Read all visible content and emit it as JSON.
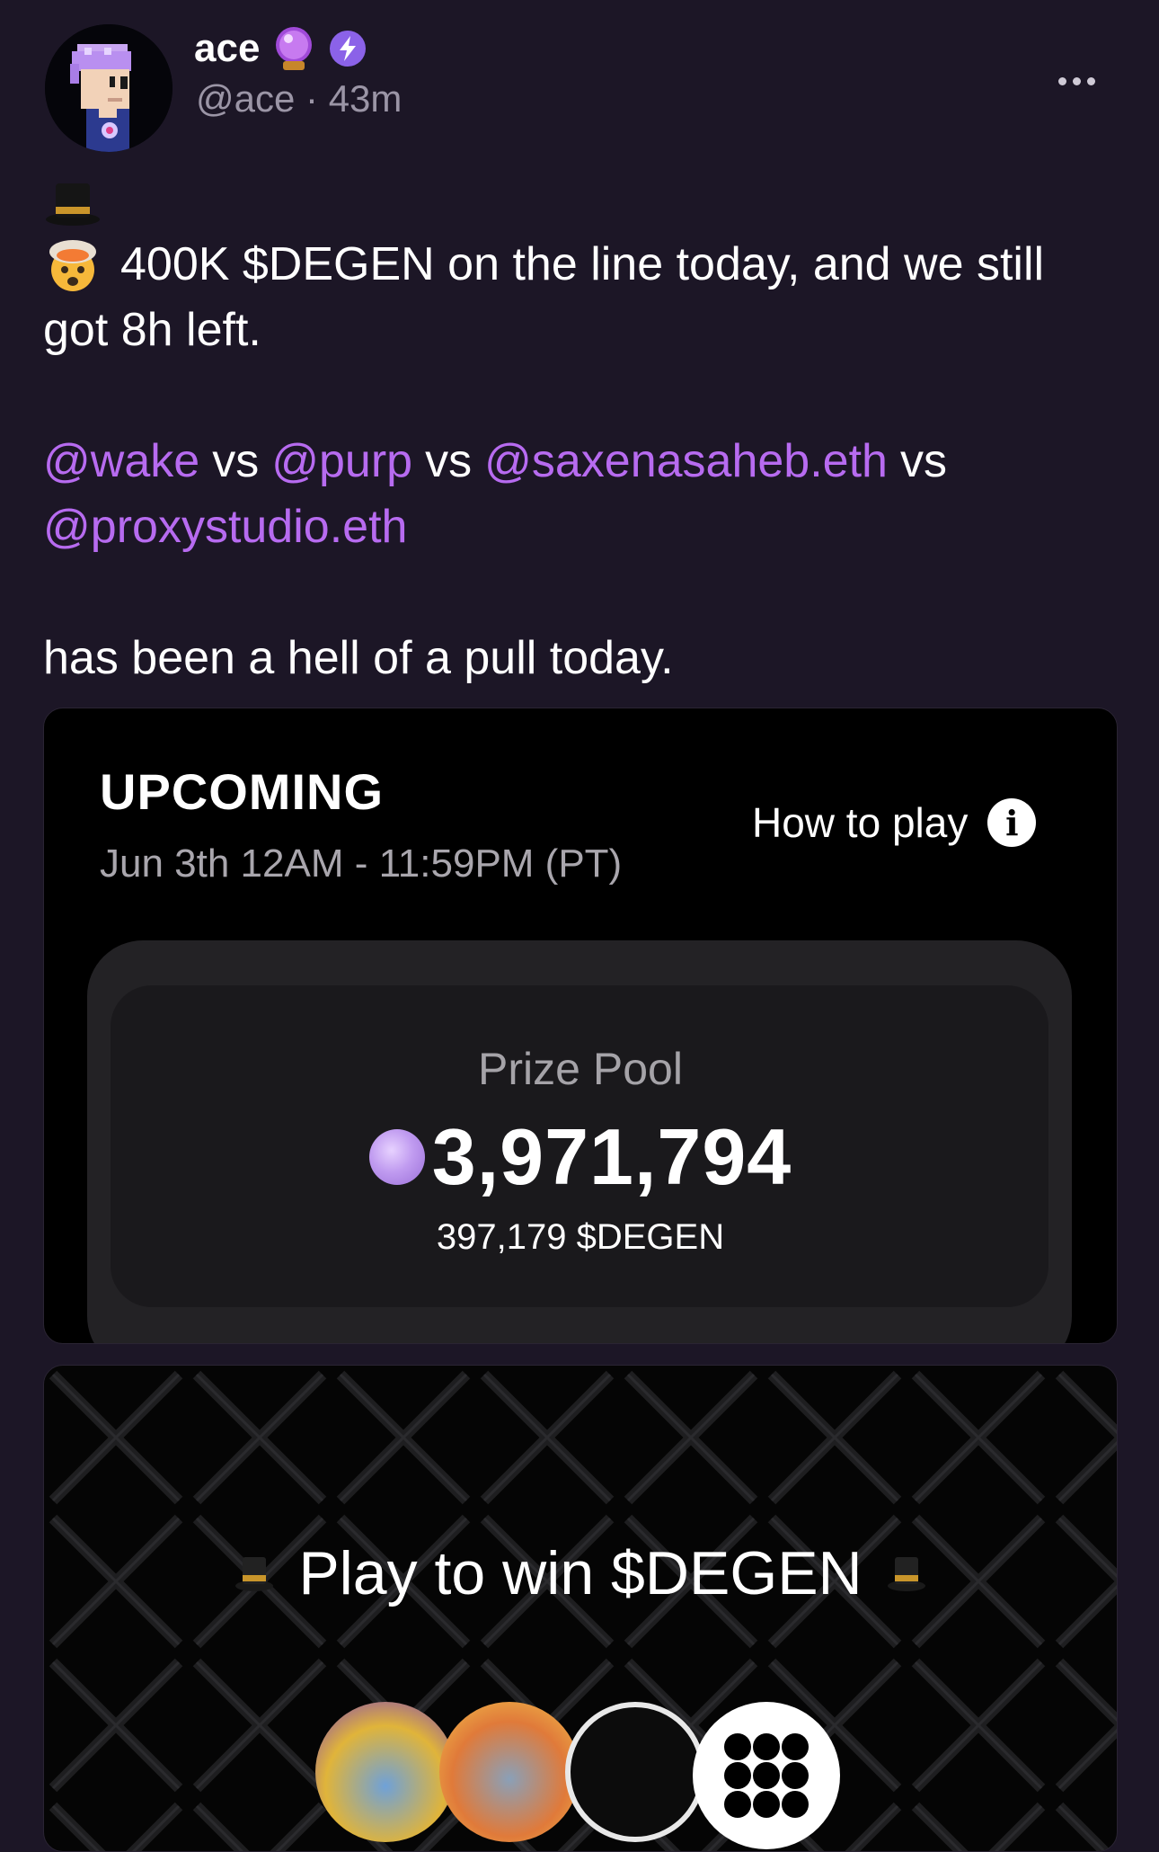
{
  "author": {
    "name": "ace",
    "handle": "@ace",
    "separator": "·",
    "time": "43m",
    "badges": [
      "crystal-ball-icon",
      "power-badge-icon"
    ]
  },
  "post": {
    "line1": "400K $DEGEN on the line today, and we still",
    "line2": "got 8h left.",
    "mentions": [
      "@wake",
      "@purp",
      "@saxenasaheb.eth",
      "@proxystudio.eth"
    ],
    "vs": "vs",
    "closing": "has been a hell of a pull today."
  },
  "card1": {
    "status": "UPCOMING",
    "date": "Jun 3th 12AM - 11:59PM (PT)",
    "how_to_play": "How to play",
    "info_glyph": "i",
    "prize_label": "Prize Pool",
    "prize_value": "3,971,794",
    "prize_sub": "397,179 $DEGEN"
  },
  "card2": {
    "cta": "Play to win $DEGEN"
  },
  "colors": {
    "background": "#1c1626",
    "mention": "#b76bf0",
    "card": "#000000",
    "coin": "#c09bf0"
  }
}
